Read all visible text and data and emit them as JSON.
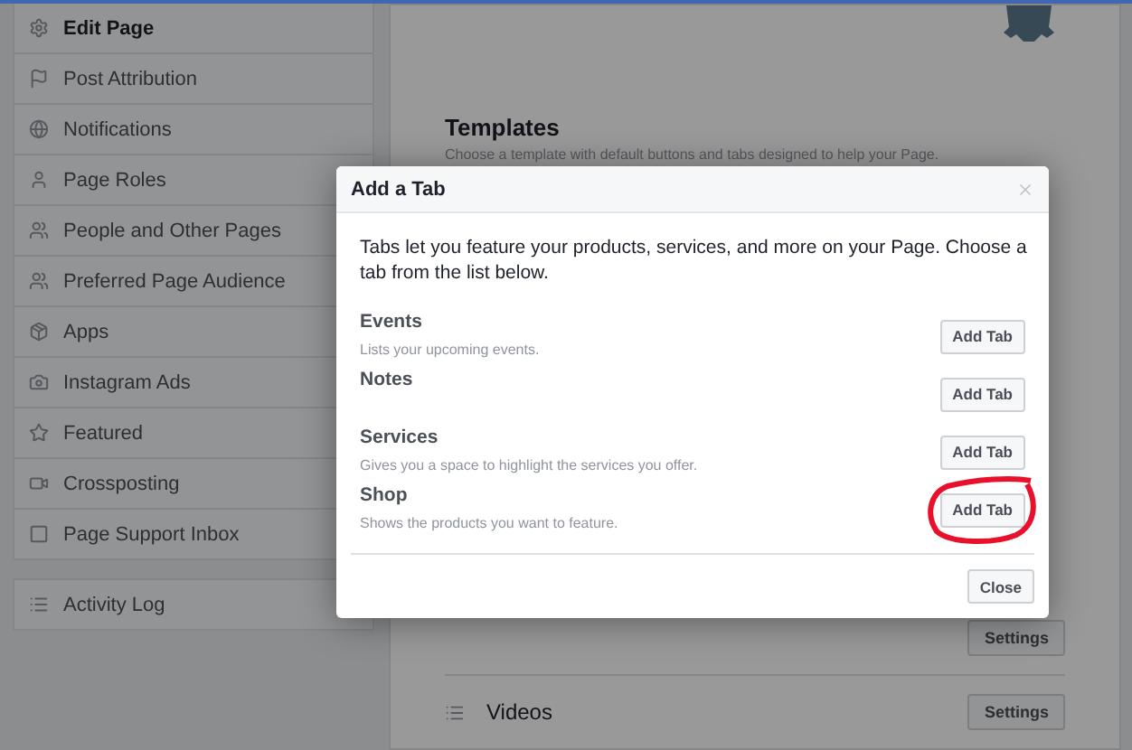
{
  "sidebar": {
    "items": [
      {
        "label": "Edit Page",
        "selected": true
      },
      {
        "label": "Post Attribution",
        "selected": false
      },
      {
        "label": "Notifications",
        "selected": false
      },
      {
        "label": "Page Roles",
        "selected": false
      },
      {
        "label": "People and Other Pages",
        "selected": false
      },
      {
        "label": "Preferred Page Audience",
        "selected": false
      },
      {
        "label": "Apps",
        "selected": false
      },
      {
        "label": "Instagram Ads",
        "selected": false
      },
      {
        "label": "Featured",
        "selected": false
      },
      {
        "label": "Crossposting",
        "selected": false
      },
      {
        "label": "Page Support Inbox",
        "selected": false
      }
    ],
    "footer_items": [
      {
        "label": "Activity Log"
      }
    ]
  },
  "main": {
    "templates": {
      "title": "Templates",
      "description": "Choose a template with default buttons and tabs designed to help your Page."
    },
    "rows": [
      {
        "button": "Settings"
      },
      {
        "label": "Videos",
        "button": "Settings"
      }
    ]
  },
  "dialog": {
    "title": "Add a Tab",
    "intro": "Tabs let you feature your products, services, and more on your Page. Choose a tab from the list below.",
    "tabs": [
      {
        "name": "Events",
        "description": "Lists your upcoming events.",
        "button": "Add Tab",
        "circled": false
      },
      {
        "name": "Notes",
        "button": "Add Tab",
        "circled": false
      },
      {
        "name": "Services",
        "description": "Gives you a space to highlight the services you offer.",
        "button": "Add Tab",
        "circled": false
      },
      {
        "name": "Shop",
        "description": "Shows the products you want to feature.",
        "button": "Add Tab",
        "circled": true
      }
    ],
    "close_button": "Close"
  }
}
